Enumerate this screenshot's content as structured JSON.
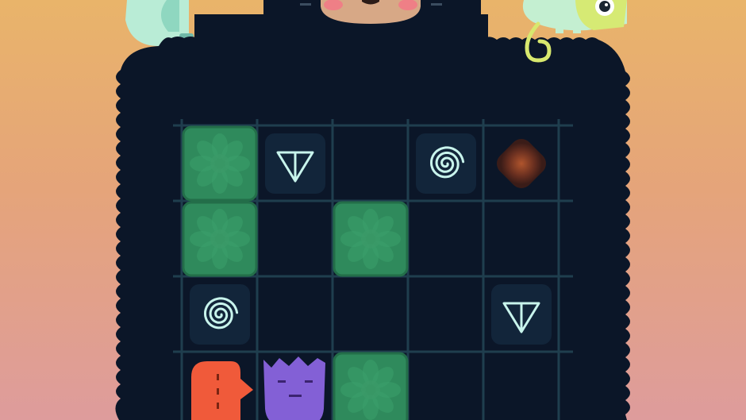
{
  "game": {
    "board": {
      "columns": 5,
      "rows": 4,
      "cells": [
        {
          "row": 0,
          "col": 0,
          "type": "bush"
        },
        {
          "row": 0,
          "col": 1,
          "type": "arrow-down-block"
        },
        {
          "row": 0,
          "col": 3,
          "type": "spiral-block"
        },
        {
          "row": 0,
          "col": 4,
          "type": "dark-seed"
        },
        {
          "row": 1,
          "col": 0,
          "type": "bush"
        },
        {
          "row": 1,
          "col": 2,
          "type": "bush"
        },
        {
          "row": 2,
          "col": 0,
          "type": "spiral-block"
        },
        {
          "row": 2,
          "col": 4,
          "type": "arrow-down-block"
        },
        {
          "row": 3,
          "col": 0,
          "type": "orange-creature"
        },
        {
          "row": 3,
          "col": 1,
          "type": "purple-creature"
        },
        {
          "row": 3,
          "col": 2,
          "type": "bush"
        }
      ]
    },
    "colors": {
      "board": "#0b1628",
      "grid": "#1f3e4e",
      "bush": "#2f8a5c",
      "symbol_block": "#12253a",
      "symbol": "#c8f4ec",
      "orange_creature": "#f05a3a",
      "purple_creature": "#8360d6",
      "dark_seed": "#6b3020"
    },
    "decorations": [
      "leaf-icon",
      "sloth-face-icon",
      "chameleon-icon"
    ]
  }
}
